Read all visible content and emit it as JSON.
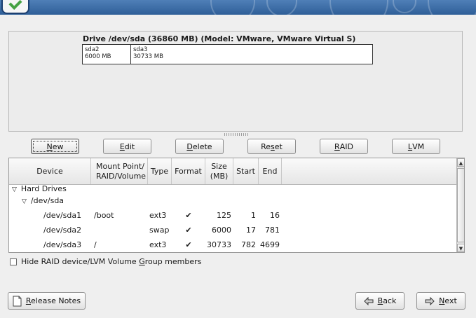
{
  "drive": {
    "title": "Drive /dev/sda (36860 MB) (Model: VMware, VMware Virtual S)",
    "partitions": [
      {
        "name": "sda2",
        "size": "6000 MB"
      },
      {
        "name": "sda3",
        "size": "30733 MB"
      }
    ]
  },
  "actions": {
    "new": {
      "pre": "",
      "key": "N",
      "post": "ew"
    },
    "edit": {
      "pre": "",
      "key": "E",
      "post": "dit"
    },
    "delete": {
      "pre": "",
      "key": "D",
      "post": "elete"
    },
    "reset": {
      "pre": "Re",
      "key": "s",
      "post": "et"
    },
    "raid": {
      "pre": "",
      "key": "R",
      "post": "AID"
    },
    "lvm": {
      "pre": "",
      "key": "L",
      "post": "VM"
    }
  },
  "table": {
    "columns": {
      "device": "Device",
      "mount_line1": "Mount Point/",
      "mount_line2": "RAID/Volume",
      "type": "Type",
      "format": "Format",
      "size_line1": "Size",
      "size_line2": "(MB)",
      "start": "Start",
      "end": "End"
    },
    "group": "Hard Drives",
    "drive": "/dev/sda",
    "check_glyph": "✔",
    "rows": [
      {
        "device": "/dev/sda1",
        "mount": "/boot",
        "type": "ext3",
        "size": "125",
        "start": "1",
        "end": "16"
      },
      {
        "device": "/dev/sda2",
        "mount": "",
        "type": "swap",
        "size": "6000",
        "start": "17",
        "end": "781"
      },
      {
        "device": "/dev/sda3",
        "mount": "/",
        "type": "ext3",
        "size": "30733",
        "start": "782",
        "end": "4699"
      }
    ]
  },
  "hide_option": {
    "pre": "Hide RAID device/LVM Volume ",
    "key": "G",
    "post": "roup members",
    "checked": false
  },
  "footer": {
    "release_notes": {
      "pre": "",
      "key": "R",
      "post": "elease Notes"
    },
    "back": {
      "pre": "",
      "key": "B",
      "post": "ack"
    },
    "next": {
      "pre": "",
      "key": "N",
      "post": "ext"
    }
  },
  "icons": {
    "release_notes": "document-icon",
    "back": "arrow-left-icon",
    "next": "arrow-right-icon",
    "expand": "triangle-down-icon"
  },
  "colors": {
    "banner": "#2f5f98",
    "panel": "#ececec"
  }
}
